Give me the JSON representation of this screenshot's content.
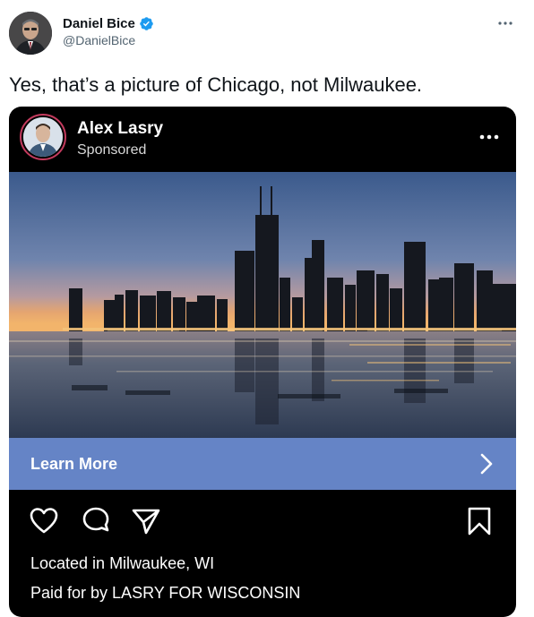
{
  "author": {
    "name": "Daniel Bice",
    "handle": "@DanielBice",
    "verified": true
  },
  "tweet": {
    "text": "Yes, that’s a picture of Chicago, not Milwaukee."
  },
  "ad": {
    "account_name": "Alex Lasry",
    "label": "Sponsored",
    "cta_label": "Learn More",
    "location_text": "Located in Milwaukee, WI",
    "paid_for_text": "Paid for by LASRY FOR WISCONSIN"
  },
  "icons": {
    "more": "more-horizontal-icon",
    "verified": "verified-badge-icon",
    "like": "heart-icon",
    "comment": "comment-bubble-icon",
    "share": "send-icon",
    "save": "bookmark-icon",
    "chevron": "chevron-right-icon"
  },
  "colors": {
    "verified_blue": "#1d9bf0",
    "cta_background": "#6584c6",
    "ad_background": "#000000",
    "handle_gray": "#536471"
  }
}
